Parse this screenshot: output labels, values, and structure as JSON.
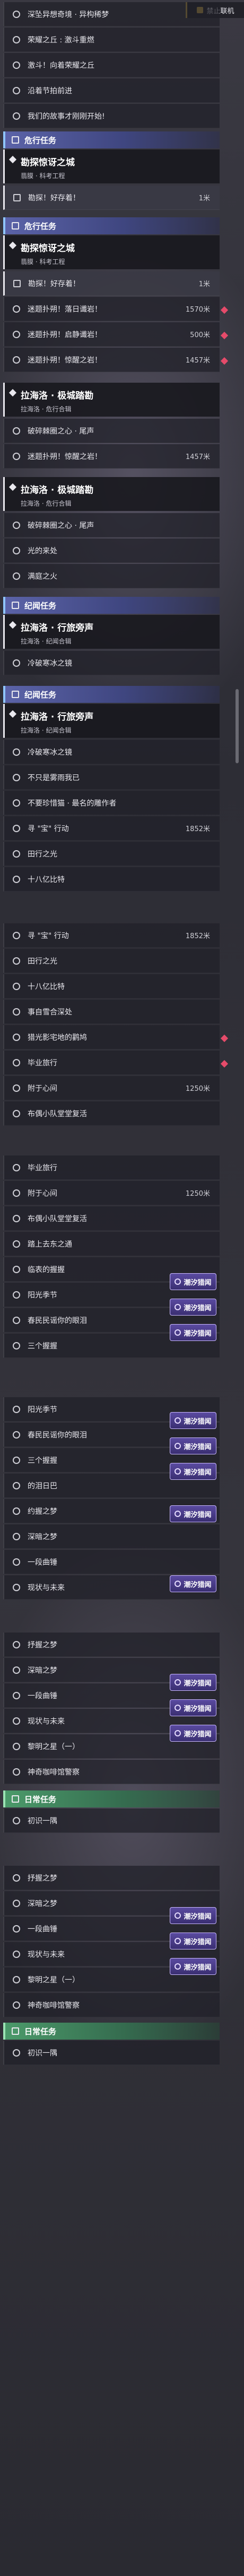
{
  "banner": {
    "label": "禁止联机"
  },
  "sections": {
    "danger1": "危行任务",
    "danger2": "危行任务",
    "legend1": "纪闻任务",
    "legend2": "纪闻任务",
    "daily1": "日常任务",
    "daily2": "日常任务"
  },
  "headers": {
    "h1": {
      "title": "勘探惊讶之城",
      "sub": "翡膜 · 科考工程"
    },
    "h2": {
      "title": "勘探惊讶之城",
      "sub": "翡膜 · 科考工程"
    },
    "h3": {
      "title": "拉海洛 · 极城踏勘",
      "sub": "拉海洛 · 危行合辑"
    },
    "h4": {
      "title": "拉海洛 · 极城踏勘",
      "sub": "拉海洛 · 危行合辑"
    },
    "h5": {
      "title": "拉海洛 · 行旅旁声",
      "sub": "拉海洛 · 纪闻合辑"
    },
    "h6": {
      "title": "拉海洛 · 行旅旁声",
      "sub": "拉海洛 · 纪闻合辑"
    }
  },
  "rows": [
    {
      "label": "深坠异想奇境 · 异构稀梦",
      "dist": ""
    },
    {
      "label": "荣耀之丘 : 激斗重燃",
      "dist": ""
    },
    {
      "label": "激斗！向着荣耀之丘",
      "dist": ""
    },
    {
      "label": "沿着节拍前进",
      "dist": ""
    },
    {
      "label": "我们的故事才刚刚开始!",
      "dist": ""
    },
    {
      "label": "勘探！好存着！",
      "dist": "1米"
    },
    {
      "label": "勘探！好存着！",
      "dist": "1米"
    },
    {
      "label": "迷题扑朔！落日谶岩！",
      "dist": "1570米"
    },
    {
      "label": "迷题扑朔！启静谶岩！",
      "dist": "500米"
    },
    {
      "label": "迷题扑朔！惊醒之岩！",
      "dist": "1457米"
    },
    {
      "label": "破碎棘圈之心 · 尾声",
      "dist": ""
    },
    {
      "label": "迷题扑朔！惊醒之岩！",
      "dist": "1457米"
    },
    {
      "label": "破碎棘圈之心 · 尾声",
      "dist": ""
    },
    {
      "label": "光的来处",
      "dist": ""
    },
    {
      "label": "满庭之火",
      "dist": ""
    },
    {
      "label": "冷破寒冰之镜",
      "dist": ""
    },
    {
      "label": "冷破寒冰之镜",
      "dist": ""
    },
    {
      "label": "不只是雾雨我已",
      "dist": ""
    },
    {
      "label": "不要珍惜猫 · 最名的雕作者",
      "dist": ""
    },
    {
      "label": "寻 \"宝\" 行动",
      "dist": "1852米"
    },
    {
      "label": "田行之光",
      "dist": ""
    },
    {
      "label": "十八亿比特",
      "dist": ""
    },
    {
      "label": "寻 \"宝\" 行动",
      "dist": "1852米"
    },
    {
      "label": "田行之光",
      "dist": ""
    },
    {
      "label": "十八亿比特",
      "dist": ""
    },
    {
      "label": "事自雪合深处",
      "dist": ""
    },
    {
      "label": "猎光影宅地的鹳鸠",
      "dist": ""
    },
    {
      "label": "毕业旅行",
      "dist": ""
    },
    {
      "label": "附于心间",
      "dist": "1250米"
    },
    {
      "label": "布偶小队堂堂复活",
      "dist": ""
    },
    {
      "label": "毕业旅行",
      "dist": ""
    },
    {
      "label": "附于心间",
      "dist": "1250米"
    },
    {
      "label": "布偶小队堂堂复活",
      "dist": ""
    },
    {
      "label": "踏上去东之通",
      "dist": ""
    },
    {
      "label": "临表的握握",
      "dist": ""
    },
    {
      "label": "阳光季节",
      "dist": ""
    },
    {
      "label": "春民民谣你的眼泪",
      "dist": ""
    },
    {
      "label": "三个握握",
      "dist": ""
    },
    {
      "label": "阳光季节",
      "dist": ""
    },
    {
      "label": "春民民谣你的眼泪",
      "dist": ""
    },
    {
      "label": "三个握握",
      "dist": ""
    },
    {
      "label": "的泪日巴",
      "dist": ""
    },
    {
      "label": "约握之梦",
      "dist": ""
    },
    {
      "label": "深暗之梦",
      "dist": ""
    },
    {
      "label": "一段曲锤",
      "dist": ""
    },
    {
      "label": "现状与未来",
      "dist": ""
    },
    {
      "label": "抒握之梦",
      "dist": ""
    },
    {
      "label": "深暗之梦",
      "dist": ""
    },
    {
      "label": "一段曲锤",
      "dist": ""
    },
    {
      "label": "现状与未来",
      "dist": ""
    },
    {
      "label": "黎明之星（一）",
      "dist": ""
    },
    {
      "label": "神奇咖啡馆警察",
      "dist": ""
    },
    {
      "label": "初识一隅",
      "dist": ""
    },
    {
      "label": "抒握之梦",
      "dist": ""
    },
    {
      "label": "深暗之梦",
      "dist": ""
    },
    {
      "label": "一段曲锤",
      "dist": ""
    },
    {
      "label": "现状与未来",
      "dist": ""
    },
    {
      "label": "黎明之星（一）",
      "dist": ""
    },
    {
      "label": "神奇咖啡馆警察",
      "dist": ""
    },
    {
      "label": "初识一隅",
      "dist": ""
    }
  ],
  "badge_label": "潮汐猎闻"
}
